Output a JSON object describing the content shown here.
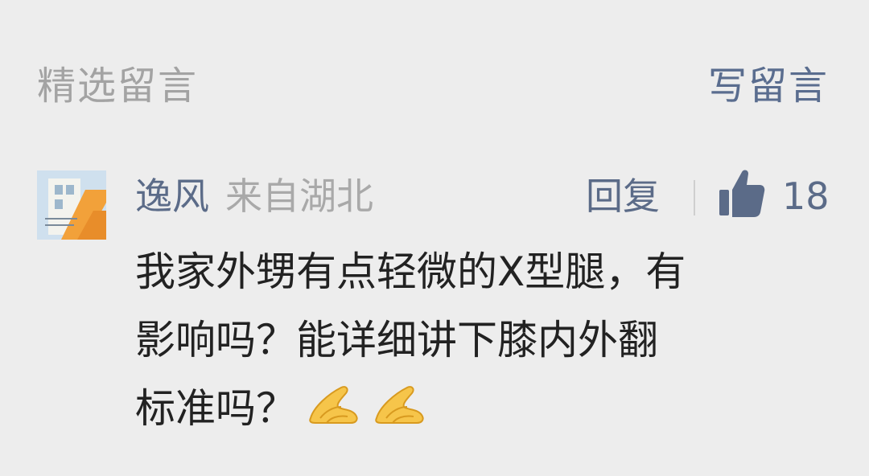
{
  "header": {
    "section_title": "精选留言",
    "write_label": "写留言"
  },
  "comment": {
    "author": "逸风",
    "region": "来自湖北",
    "reply_label": "回复",
    "like_count": "18",
    "lines": [
      "我家外甥有点轻微的X型腿，有",
      "影响吗？能详细讲下膝内外翻",
      "标准吗？"
    ],
    "emoji": [
      "folded-hands",
      "folded-hands"
    ]
  },
  "colors": {
    "background": "#ededed",
    "muted_title": "#a3a3a3",
    "link_blue": "#5b6b88",
    "region_gray": "#a9a9a9",
    "body_text": "#222222"
  }
}
